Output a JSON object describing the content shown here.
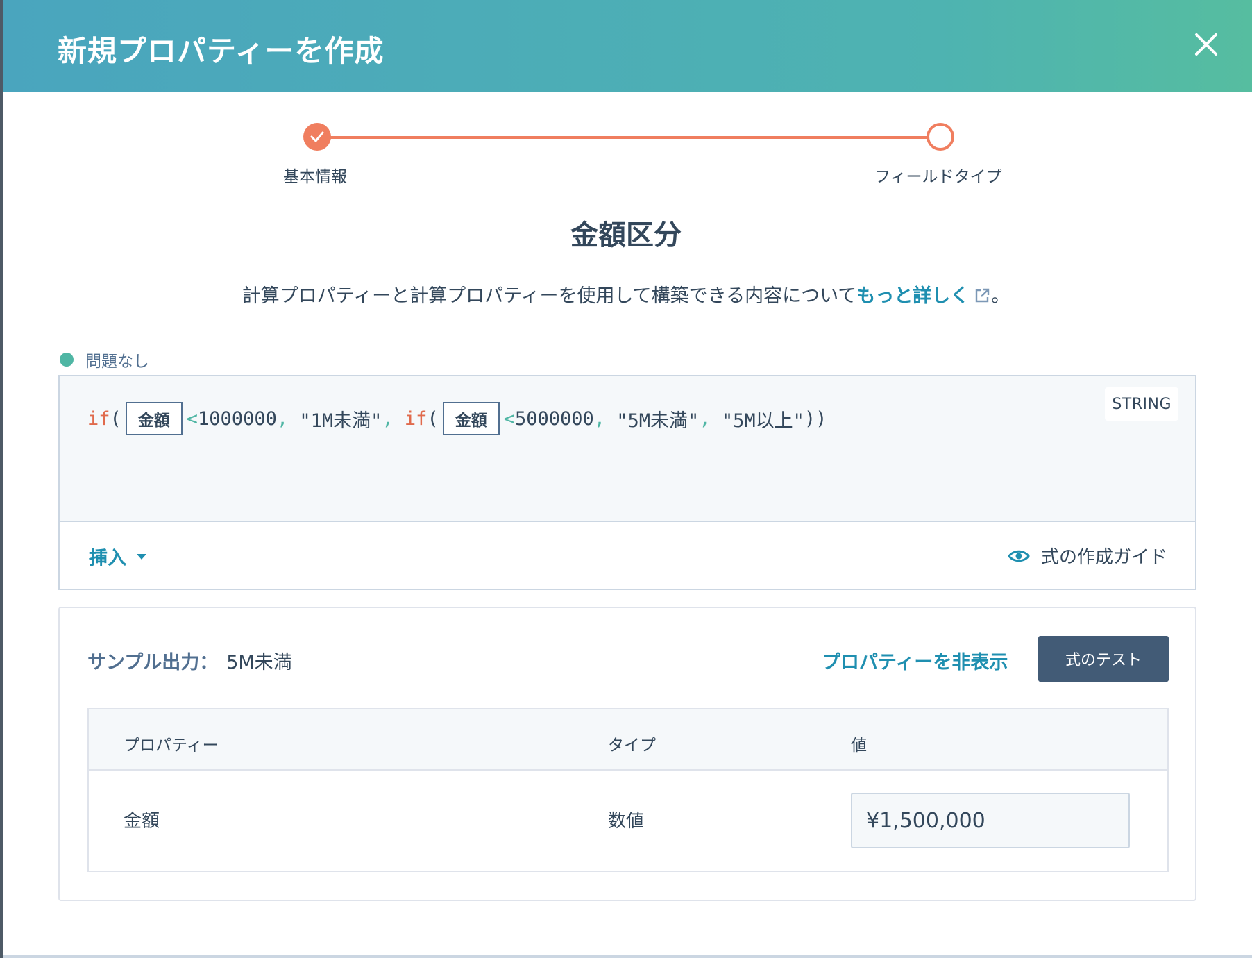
{
  "header": {
    "title": "新規プロパティーを作成"
  },
  "stepper": {
    "steps": [
      {
        "label": "基本情報",
        "state": "complete"
      },
      {
        "label": "フィールドタイプ",
        "state": "current"
      }
    ],
    "accent_color": "#f07e5f"
  },
  "property": {
    "name": "金額区分"
  },
  "description": {
    "text": "計算プロパティーと計算プロパティーを使用して構築できる内容について",
    "link_text": "もっと詳しく",
    "suffix": "。"
  },
  "status": {
    "text": "問題なし",
    "color": "#4fb6a4"
  },
  "editor": {
    "type_badge": "STRING",
    "code": {
      "kw1": "if",
      "open1": "(",
      "token1": "金額",
      "lt1": "<",
      "num1": "1000000",
      "comma1": ",",
      "str1": " \"1M未満\"",
      "comma2": ",",
      "kw2": " if",
      "open2": "(",
      "token2": "金額",
      "lt2": "<",
      "num2": "5000000",
      "comma3": ",",
      "str2": " \"5M未満\"",
      "comma4": ",",
      "str3": " \"5M以上\"",
      "close": "))"
    },
    "insert_label": "挿入",
    "guide_label": "式の作成ガイド"
  },
  "sample": {
    "label": "サンプル出力：",
    "value": "5M未満",
    "hide_properties": "プロパティーを非表示",
    "test_button": "式のテスト",
    "table": {
      "headers": [
        "プロパティー",
        "タイプ",
        "値"
      ],
      "rows": [
        {
          "property": "金額",
          "type": "数値",
          "value": "¥1,500,000"
        }
      ]
    }
  }
}
